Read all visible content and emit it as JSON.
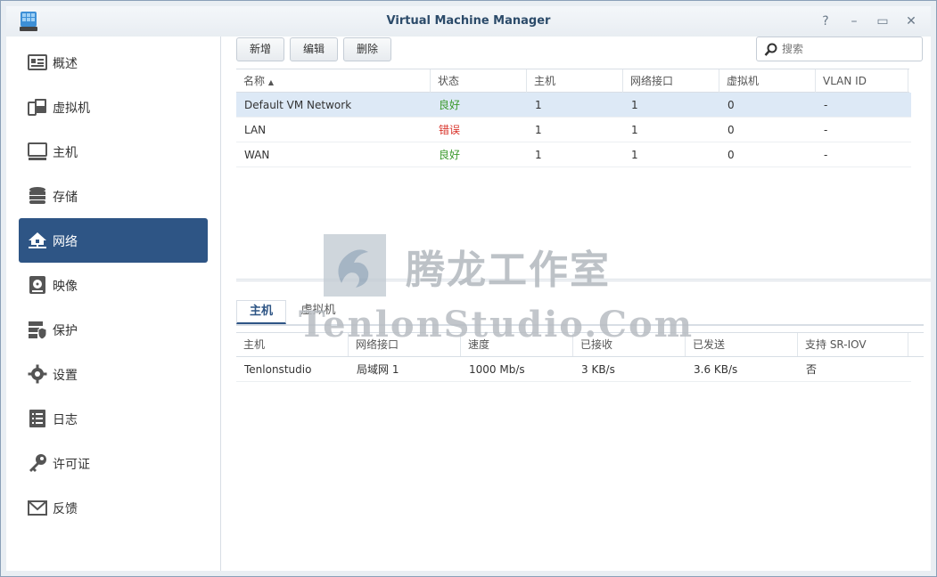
{
  "window": {
    "title": "Virtual Machine Manager",
    "controls": [
      "?",
      "–",
      "▭",
      "✕"
    ]
  },
  "sidebar": {
    "items": [
      {
        "label": "概述",
        "icon": "overview-icon"
      },
      {
        "label": "虚拟机",
        "icon": "vm-icon"
      },
      {
        "label": "主机",
        "icon": "monitor-icon"
      },
      {
        "label": "存储",
        "icon": "storage-icon"
      },
      {
        "label": "网络",
        "icon": "network-home-icon",
        "active": true
      },
      {
        "label": "映像",
        "icon": "disk-image-icon"
      },
      {
        "label": "保护",
        "icon": "protection-icon"
      },
      {
        "label": "设置",
        "icon": "gear-icon"
      },
      {
        "label": "日志",
        "icon": "log-icon"
      },
      {
        "label": "许可证",
        "icon": "key-icon"
      },
      {
        "label": "反馈",
        "icon": "mail-icon"
      }
    ]
  },
  "toolbar": {
    "add_label": "新增",
    "edit_label": "编辑",
    "delete_label": "删除"
  },
  "search": {
    "placeholder": "搜索"
  },
  "networks": {
    "columns": [
      "名称",
      "状态",
      "主机",
      "网络接口",
      "虚拟机",
      "VLAN ID"
    ],
    "sort_indicator": "▲",
    "rows": [
      {
        "name": "Default VM Network",
        "status": "良好",
        "status_type": "ok",
        "host": "1",
        "iface": "1",
        "vm": "0",
        "vlan": "-"
      },
      {
        "name": "LAN",
        "status": "错误",
        "status_type": "error",
        "host": "1",
        "iface": "1",
        "vm": "0",
        "vlan": "-"
      },
      {
        "name": "WAN",
        "status": "良好",
        "status_type": "ok",
        "host": "1",
        "iface": "1",
        "vm": "0",
        "vlan": "-"
      }
    ]
  },
  "detail": {
    "tabs": [
      "主机",
      "虚拟机"
    ],
    "columns": [
      "主机",
      "网络接口",
      "速度",
      "已接收",
      "已发送",
      "支持 SR-IOV"
    ],
    "rows": [
      {
        "host": "Tenlonstudio",
        "iface": "局域网 1",
        "speed": "1000 Mb/s",
        "received": "3 KB/s",
        "sent": "3.6 KB/s",
        "sriov": "否"
      }
    ]
  },
  "watermark": {
    "cn": "腾龙工作室",
    "en": "TenlonStudio.Com"
  },
  "colors": {
    "accent": "#2e5585",
    "ok": "#3c9a2d",
    "error": "#d9342b"
  }
}
